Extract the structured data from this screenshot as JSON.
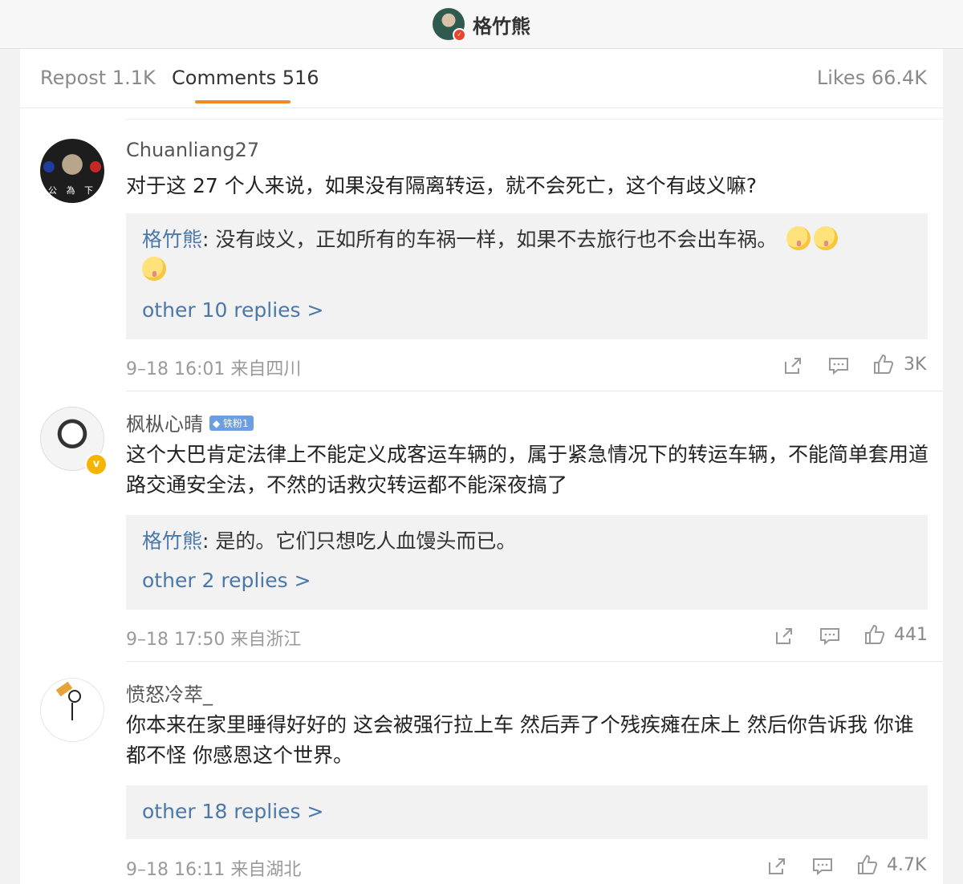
{
  "header": {
    "title": "格竹熊"
  },
  "tabs": {
    "repost": "Repost 1.1K",
    "comments": "Comments 516",
    "likes": "Likes 66.4K"
  },
  "comments": [
    {
      "username": "Chuanliang27",
      "text": "对于这 27 个人来说，如果没有隔离转运，就不会死亡，这个有歧义嘛?",
      "reply_author": "格竹熊",
      "reply_text": ": 没有歧义，正如所有的车祸一样，如果不去旅行也不会出车祸。",
      "other_replies": "other 10 replies >",
      "meta": "9–18 16:01 来自四川",
      "likes": "3K"
    },
    {
      "username": "枫枞心晴",
      "fan_badge": "铁粉1",
      "text": "这个大巴肯定法律上不能定义成客运车辆的，属于紧急情况下的转运车辆，不能简单套用道路交通安全法，不然的话救灾转运都不能深夜搞了",
      "reply_author": "格竹熊",
      "reply_text": ": 是的。它们只想吃人血馒头而已。",
      "other_replies": "other 2 replies >",
      "meta": "9–18 17:50 来自浙江",
      "likes": "441"
    },
    {
      "username": "愤怒冷萃_",
      "text": "你本来在家里睡得好好的 这会被强行拉上车 然后弄了个残疾瘫在床上 然后你告诉我 你谁都不怪 你感恩这个世界。",
      "other_replies": "other 18 replies >",
      "meta": "9–18 16:11 来自湖北",
      "likes": "4.7K"
    }
  ],
  "icons": {
    "share": "share-icon",
    "comment": "comment-icon",
    "like": "thumbs-up-icon",
    "emoji": "shush-emoji-icon"
  },
  "colors": {
    "accent_tab": "#f08a24",
    "link": "#4a78a8",
    "verified": "#f5b400"
  }
}
